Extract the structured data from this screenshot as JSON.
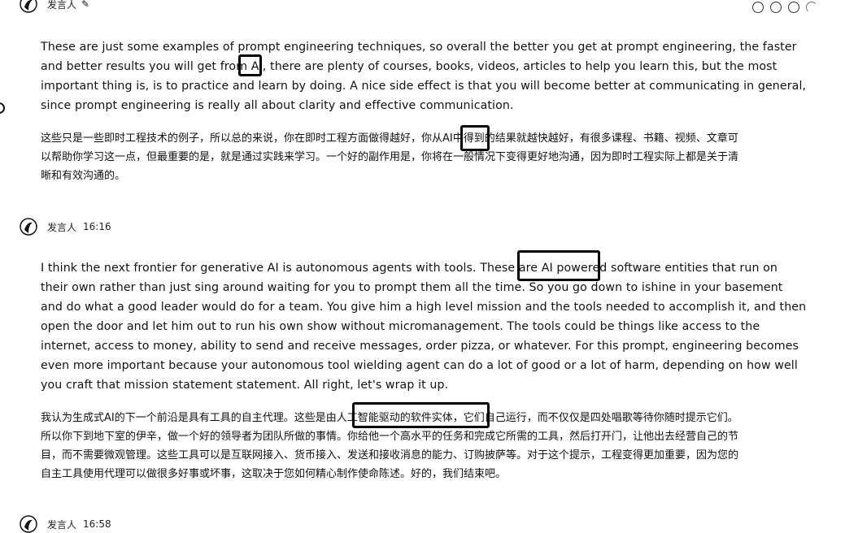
{
  "speaker_blocks": [
    {
      "name": "发言人",
      "time": "",
      "has_edit_icon": true
    },
    {
      "name": "发言人",
      "time": "16:16",
      "has_edit_icon": false
    },
    {
      "name": "发言人",
      "time": "16:58",
      "has_edit_icon": false
    }
  ],
  "block1": {
    "en_lines": [
      "These are just some examples of prompt engineering techniques, so overall the better you get at prompt engineering, the faster",
      "and better results you will get from AI, there are plenty of courses, books, videos, articles to help you learn this, but the most",
      "important thing is, is to practice and learn by doing. A nice side effect is that you will become better at communicating in general,",
      "since prompt engineering is really all about clarity and effective communication."
    ],
    "zh_lines": [
      "这些只是一些即时工程技术的例子，所以总的来说，你在即时工程方面做得越好，你从AI中得到的结果就越快越好，有很多课程、书籍、视频、文章可",
      "以帮助你学习这一点，但最重要的是，就是通过实践来学习。一个好的副作用是，你将在一般情况下变得更好地沟通，因为即时工程实际上都是关于清",
      "晰和有效沟通的。"
    ]
  },
  "block2": {
    "en_lines": [
      "I think the next frontier for generative AI is autonomous agents with tools. These are AI powered software entities that run on",
      "their own rather than just sing around waiting for you to prompt them all the time. So you go down to ishine in your basement",
      "and do what a good leader would do for a team. You give him a high level mission and the tools needed to accomplish it, and then",
      "open the door and let him out to run his own show without micromanagement. The tools could be things like access to the",
      "internet, access to money, ability to send and receive messages, order pizza, or whatever. For this prompt, engineering becomes",
      "even more important because your autonomous tool wielding agent can do a lot of good or a lot of harm, depending on how well",
      "you craft that mission statement statement. All right, let's wrap it up."
    ],
    "zh_lines": [
      "我认为生成式AI的下一个前沿是具有工具的自主代理。这些是由人工智能驱动的软件实体，它们自己运行，而不仅仅是四处唱歌等待你随时提示它们。",
      "所以你下到地下室的伊辛，做一个好的领导者为团队所做的事情。你给他一个高水平的任务和完成它所需的工具，然后打开门，让他出去经营自己的节",
      "目，而不需要微观管理。这些工具可以是互联网接入、货币接入、发送和接收消息的能力、订购披萨等。对于这个提示，工程变得更加重要，因为您的",
      "自主工具使用代理可以做很多好事或坏事，这取决于您如何精心制作使命陈述。好的，我们结束吧。"
    ]
  },
  "icons": [
    "avatar-icon",
    "edit-icon",
    "status-ring-icon"
  ]
}
